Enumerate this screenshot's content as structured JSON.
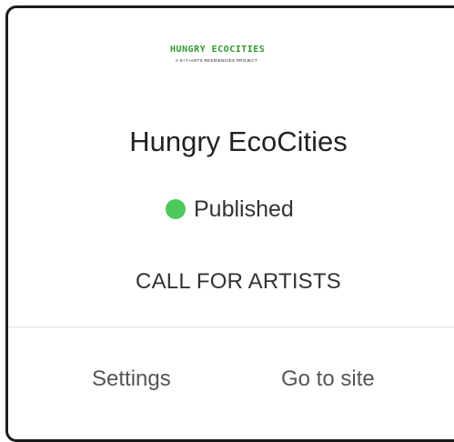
{
  "logo": {
    "name": "HUNGRY ECOCITIES",
    "tagline": "A S+T+ARTS RESIDENCIES PROJECT"
  },
  "site": {
    "title": "Hungry EcoCities",
    "status": "Published",
    "status_color": "#4cc95a",
    "page_label": "CALL FOR ARTISTS"
  },
  "actions": {
    "settings_label": "Settings",
    "go_to_site_label": "Go to site"
  }
}
